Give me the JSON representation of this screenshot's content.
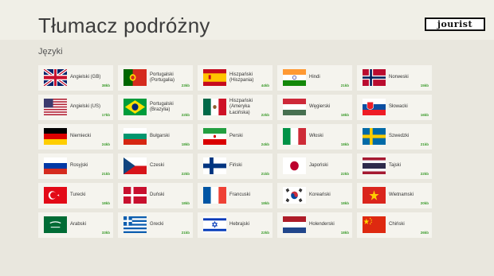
{
  "app": {
    "title": "Tłumacz podróżny",
    "logo_text": "jourist"
  },
  "section": {
    "title": "Języki"
  },
  "languages": [
    {
      "name": "Angielski (GB)",
      "size": "38kb",
      "flag": "flag-uk-icon"
    },
    {
      "name": "Portugalski (Portugalia)",
      "size": "23kb",
      "flag": "flag-portugal-icon"
    },
    {
      "name": "Hiszpański (Hiszpania)",
      "size": "44kb",
      "flag": "flag-spain-icon"
    },
    {
      "name": "Hindi",
      "size": "21kb",
      "flag": "flag-india-icon"
    },
    {
      "name": "Norweski",
      "size": "15kb",
      "flag": "flag-norway-icon"
    },
    {
      "name": "Angielski (US)",
      "size": "17kb",
      "flag": "flag-us-icon"
    },
    {
      "name": "Portugalski (Brazylia)",
      "size": "22kb",
      "flag": "flag-brazil-icon"
    },
    {
      "name": "Hiszpański (Ameryka Łacińska)",
      "size": "22kb",
      "flag": "flag-mexico-icon"
    },
    {
      "name": "Węgierski",
      "size": "18kb",
      "flag": "flag-hungary-icon"
    },
    {
      "name": "Słowacki",
      "size": "16kb",
      "flag": "flag-slovakia-icon"
    },
    {
      "name": "Niemiecki",
      "size": "24kb",
      "flag": "flag-germany-icon"
    },
    {
      "name": "Bułgarski",
      "size": "18kb",
      "flag": "flag-bulgaria-icon"
    },
    {
      "name": "Perski",
      "size": "24kb",
      "flag": "flag-iran-icon"
    },
    {
      "name": "Włoski",
      "size": "18kb",
      "flag": "flag-italy-icon"
    },
    {
      "name": "Szwedzki",
      "size": "21kb",
      "flag": "flag-sweden-icon"
    },
    {
      "name": "Rosyjski",
      "size": "21kb",
      "flag": "flag-russia-icon"
    },
    {
      "name": "Czeski",
      "size": "22kb",
      "flag": "flag-czech-icon"
    },
    {
      "name": "Fiński",
      "size": "21kb",
      "flag": "flag-finland-icon"
    },
    {
      "name": "Japoński",
      "size": "22kb",
      "flag": "flag-japan-icon"
    },
    {
      "name": "Tajski",
      "size": "22kb",
      "flag": "flag-thailand-icon"
    },
    {
      "name": "Turecki",
      "size": "18kb",
      "flag": "flag-turkey-icon"
    },
    {
      "name": "Duński",
      "size": "18kb",
      "flag": "flag-denmark-icon"
    },
    {
      "name": "Francuski",
      "size": "18kb",
      "flag": "flag-france-icon"
    },
    {
      "name": "Koreański",
      "size": "18kb",
      "flag": "flag-korea-icon"
    },
    {
      "name": "Wietnamski",
      "size": "20kb",
      "flag": "flag-vietnam-icon"
    },
    {
      "name": "Arabski",
      "size": "33kb",
      "flag": "flag-saudi-arabia-icon"
    },
    {
      "name": "Grecki",
      "size": "21kb",
      "flag": "flag-greece-icon"
    },
    {
      "name": "Hebrajski",
      "size": "22kb",
      "flag": "flag-israel-icon"
    },
    {
      "name": "Holenderski",
      "size": "18kb",
      "flag": "flag-netherlands-icon"
    },
    {
      "name": "Chiński",
      "size": "26kb",
      "flag": "flag-china-icon"
    }
  ],
  "colors": {
    "background": "#e9e7de",
    "tile": "#f5f4ee",
    "size_text": "#3a9a2a"
  }
}
